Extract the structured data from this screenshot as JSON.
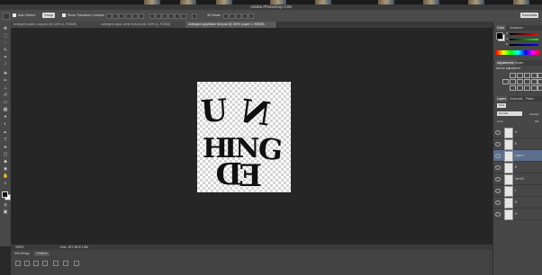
{
  "app": {
    "window_title": "Adobe Photoshop CS6"
  },
  "options_bar": {
    "auto_select_label": "Auto-Select:",
    "auto_select_value": "Group",
    "show_transform_label": "Show Transform Controls",
    "mode_label": "3D Mode:",
    "workspace_value": "Essentials"
  },
  "tabs": [
    {
      "label": "unhinged poster copy.psd @ 100% (L, RGB/8)",
      "active": false
    },
    {
      "label": "unhinged copy1 white font.psd @ 100% (L, RGB/8)",
      "active": false
    },
    {
      "label": "unhinged copy/black font.psd @ 100% (Layer 1, RGB/8)",
      "active": true
    }
  ],
  "artwork": {
    "letters": [
      "U",
      "N",
      "H",
      "I",
      "N",
      "G",
      "E",
      "D"
    ]
  },
  "status": {
    "zoom": "100%",
    "doc_info": "Doc: 157.9K/2.13M"
  },
  "bottom_panel": {
    "tabs": [
      "Mini Bridge",
      "Timeline"
    ]
  },
  "panels": {
    "color": {
      "tabs": [
        "Color",
        "Swatches"
      ],
      "slider_labels": [
        "R",
        "G",
        "B"
      ]
    },
    "adjustments": {
      "tabs": [
        "Adjustments",
        "Styles"
      ],
      "hint": "Add an adjustment"
    },
    "layers": {
      "tabs": [
        "Layers",
        "Channels",
        "Paths"
      ],
      "filter_kind": "Kind",
      "blend_mode": "Normal",
      "opacity_label": "Opacity:",
      "lock_label": "Lock:",
      "fill_label": "Fill:",
      "items": [
        {
          "name": "H",
          "selected": false
        },
        {
          "name": "E",
          "selected": false
        },
        {
          "name": "Layer 1",
          "selected": true
        },
        {
          "name": "D",
          "selected": false
        },
        {
          "name": "Inv'd N",
          "selected": false
        },
        {
          "name": "I",
          "selected": false
        },
        {
          "name": "N",
          "selected": false
        },
        {
          "name": "G",
          "selected": false
        }
      ]
    }
  },
  "colors": {
    "foreground": "#000000",
    "background": "#ffffff",
    "selected_layer": "#5c6f8e"
  }
}
